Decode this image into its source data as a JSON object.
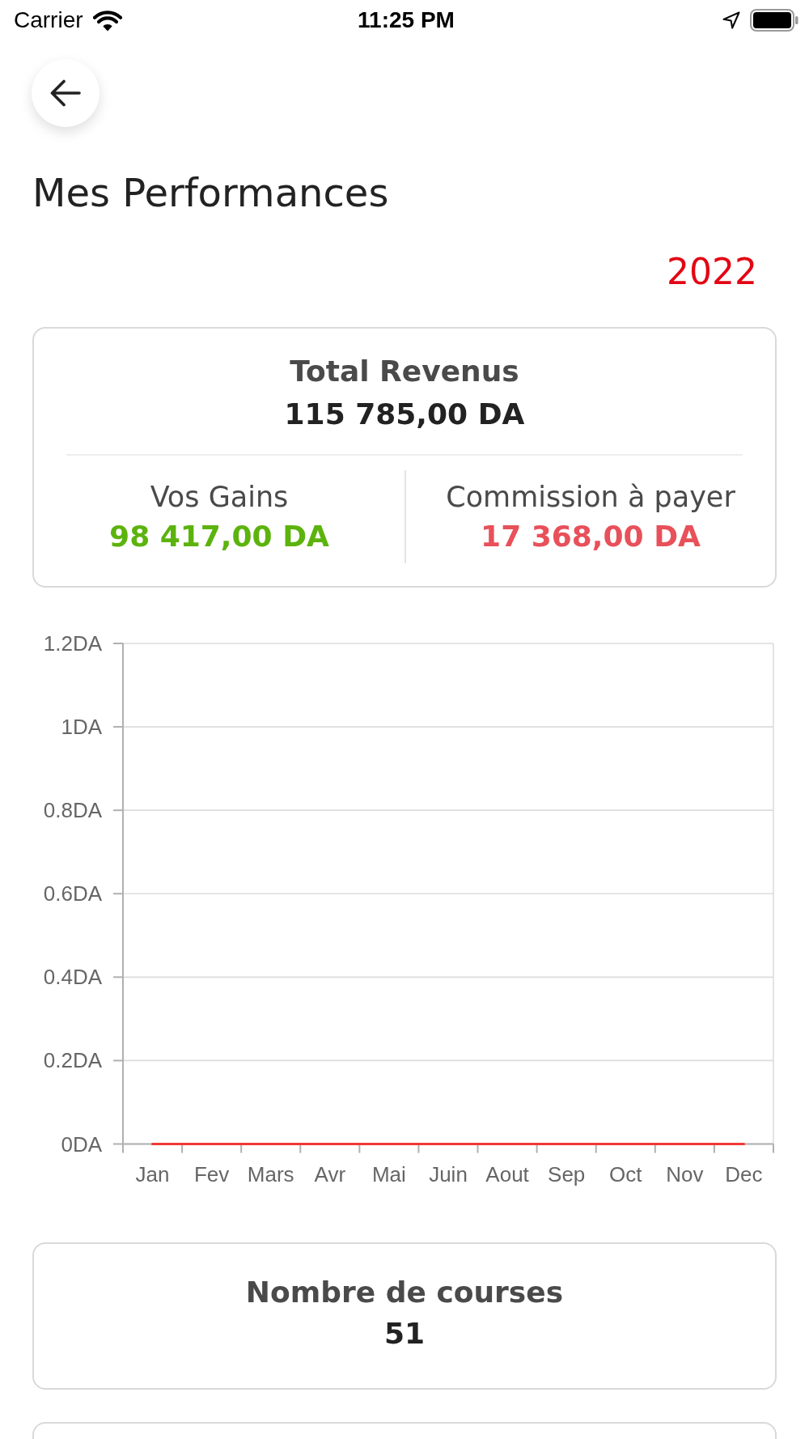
{
  "status_bar": {
    "carrier": "Carrier",
    "time": "11:25 PM"
  },
  "header": {
    "title": "Mes Performances",
    "year": "2022"
  },
  "revenue_card": {
    "title": "Total Revenus",
    "total": "115 785,00 DA",
    "columns": [
      {
        "label": "Vos Gains",
        "value": "98 417,00 DA",
        "color": "#5cb30d"
      },
      {
        "label": "Commission à payer",
        "value": "17 368,00 DA",
        "color": "#e8505a"
      }
    ]
  },
  "chart": {
    "chart_data": {
      "type": "line",
      "categories": [
        "Jan",
        "Fev",
        "Mars",
        "Avr",
        "Mai",
        "Juin",
        "Aout",
        "Sep",
        "Oct",
        "Nov",
        "Dec"
      ],
      "series": [
        {
          "color": "#ef3b36",
          "values": [
            0,
            0,
            0,
            0,
            0,
            0,
            0,
            0,
            0,
            0,
            0
          ]
        }
      ],
      "ylim": [
        0,
        1.2
      ],
      "yticks": [
        {
          "value": 0,
          "label": "0DA"
        },
        {
          "value": 0.2,
          "label": "0.2DA"
        },
        {
          "value": 0.4,
          "label": "0.4DA"
        },
        {
          "value": 0.6,
          "label": "0.6DA"
        },
        {
          "value": 0.8,
          "label": "0.8DA"
        },
        {
          "value": 1,
          "label": "1DA"
        },
        {
          "value": 1.2,
          "label": "1.2DA"
        }
      ],
      "grid": true
    }
  },
  "cards": [
    {
      "title": "Nombre de courses",
      "value": "51"
    }
  ]
}
